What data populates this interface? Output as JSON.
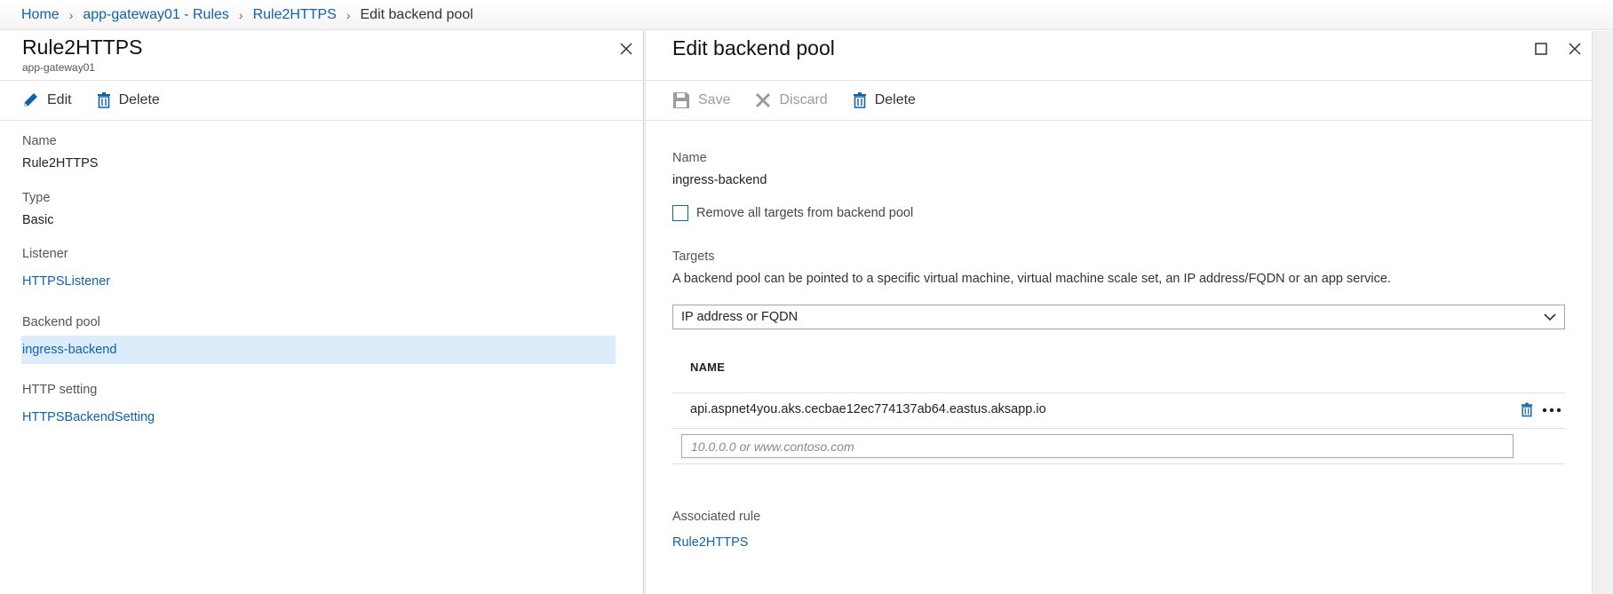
{
  "breadcrumb": {
    "items": [
      "Home",
      "app-gateway01 - Rules",
      "Rule2HTTPS"
    ],
    "current": "Edit backend pool"
  },
  "left_blade": {
    "title": "Rule2HTTPS",
    "subtitle": "app-gateway01",
    "toolbar": {
      "edit": "Edit",
      "delete": "Delete"
    },
    "properties": {
      "name_label": "Name",
      "name_value": "Rule2HTTPS",
      "type_label": "Type",
      "type_value": "Basic",
      "listener_label": "Listener",
      "listener_value": "HTTPSListener",
      "backend_label": "Backend pool",
      "backend_value": "ingress-backend",
      "http_label": "HTTP setting",
      "http_value": "HTTPSBackendSetting"
    }
  },
  "right_blade": {
    "title": "Edit backend pool",
    "toolbar": {
      "save": "Save",
      "discard": "Discard",
      "delete": "Delete"
    },
    "name_label": "Name",
    "name_value": "ingress-backend",
    "remove_targets_label": "Remove all targets from backend pool",
    "targets_label": "Targets",
    "targets_description": "A backend pool can be pointed to a specific virtual machine, virtual machine scale set, an IP address/FQDN or an app service.",
    "target_type_selected": "IP address or FQDN",
    "table": {
      "column_name": "NAME",
      "rows": [
        "api.aspnet4you.aks.cecbae12ec774137ab64.eastus.aksapp.io"
      ],
      "new_placeholder": "10.0.0.0 or www.contoso.com"
    },
    "associated_rule_label": "Associated rule",
    "associated_rule_value": "Rule2HTTPS"
  },
  "colors": {
    "link": "#0f62ad",
    "selected_row": "#dcecfb",
    "icon_blue": "#0f62ad"
  }
}
